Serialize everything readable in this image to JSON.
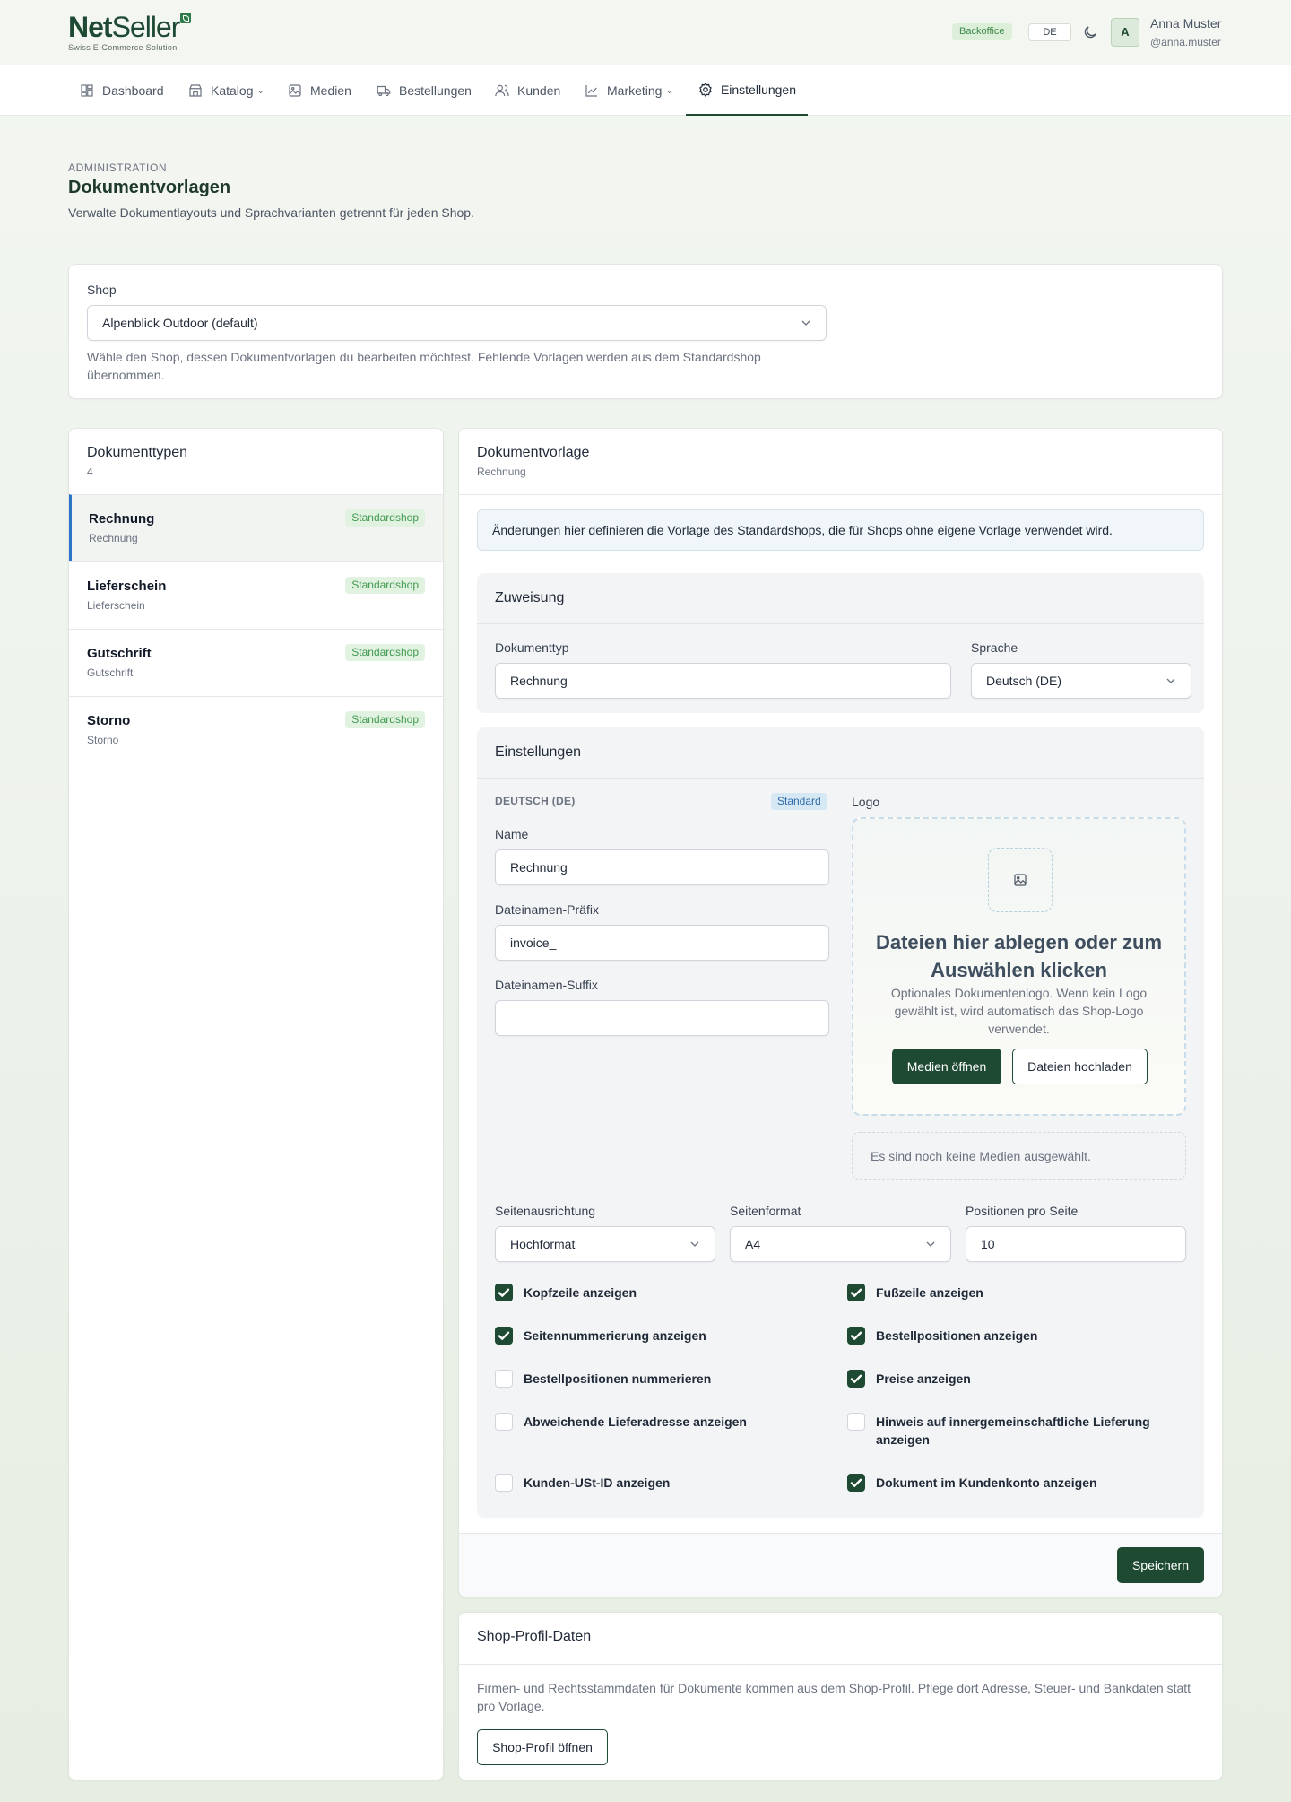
{
  "brand": {
    "name_bold": "Net",
    "name_rest": "Seller",
    "tagline": "Swiss E-Commerce Solution"
  },
  "header": {
    "backoffice_badge": "Backoffice",
    "language": "DE",
    "avatar_initial": "A",
    "user_name": "Anna Muster",
    "user_handle": "@anna.muster"
  },
  "nav": {
    "items": [
      {
        "label": "Dashboard",
        "icon": "dashboard-icon",
        "active": false
      },
      {
        "label": "Katalog",
        "icon": "store-icon",
        "active": false,
        "dropdown": true
      },
      {
        "label": "Medien",
        "icon": "image-icon",
        "active": false
      },
      {
        "label": "Bestellungen",
        "icon": "truck-icon",
        "active": false
      },
      {
        "label": "Kunden",
        "icon": "users-icon",
        "active": false
      },
      {
        "label": "Marketing",
        "icon": "chart-icon",
        "active": false,
        "dropdown": true
      },
      {
        "label": "Einstellungen",
        "icon": "gear-icon",
        "active": true
      }
    ]
  },
  "page": {
    "eyebrow": "ADMINISTRATION",
    "title": "Dokumentvorlagen",
    "subtitle": "Verwalte Dokumentlayouts und Sprachvarianten getrennt für jeden Shop."
  },
  "shop": {
    "label": "Shop",
    "value": "Alpenblick Outdoor (default)",
    "help": "Wähle den Shop, dessen Dokumentvorlagen du bearbeiten möchtest. Fehlende Vorlagen werden aus dem Standardshop übernommen."
  },
  "types": {
    "title": "Dokumenttypen",
    "count": "4",
    "items": [
      {
        "title": "Rechnung",
        "subtitle": "Rechnung",
        "badge": "Standardshop",
        "active": true
      },
      {
        "title": "Lieferschein",
        "subtitle": "Lieferschein",
        "badge": "Standardshop",
        "active": false
      },
      {
        "title": "Gutschrift",
        "subtitle": "Gutschrift",
        "badge": "Standardshop",
        "active": false
      },
      {
        "title": "Storno",
        "subtitle": "Storno",
        "badge": "Standardshop",
        "active": false
      }
    ]
  },
  "template": {
    "title": "Dokumentvorlage",
    "subtitle": "Rechnung",
    "info": "Änderungen hier definieren die Vorlage des Standardshops, die für Shops ohne eigene Vorlage verwendet wird.",
    "assignment": {
      "title": "Zuweisung",
      "doctype_label": "Dokumenttyp",
      "doctype_value": "Rechnung",
      "language_label": "Sprache",
      "language_value": "Deutsch (DE)"
    },
    "settings": {
      "title": "Einstellungen",
      "lang_heading": "DEUTSCH (DE)",
      "lang_badge": "Standard",
      "name_label": "Name",
      "name_value": "Rechnung",
      "prefix_label": "Dateinamen-Präfix",
      "prefix_value": "invoice_",
      "suffix_label": "Dateinamen-Suffix",
      "suffix_value": "",
      "logo_label": "Logo",
      "drop_title": "Dateien hier ablegen oder zum Auswählen klicken",
      "drop_help": "Optionales Dokumentenlogo. Wenn kein Logo gewählt ist, wird automatisch das Shop-Logo verwendet.",
      "open_media": "Medien öffnen",
      "upload": "Dateien hochladen",
      "no_media": "Es sind noch keine Medien ausgewählt.",
      "orientation_label": "Seitenausrichtung",
      "orientation_value": "Hochformat",
      "format_label": "Seitenformat",
      "format_value": "A4",
      "per_page_label": "Positionen pro Seite",
      "per_page_value": "10",
      "checkboxes": [
        {
          "label": "Kopfzeile anzeigen",
          "checked": true
        },
        {
          "label": "Fußzeile anzeigen",
          "checked": true
        },
        {
          "label": "Seitennummerierung anzeigen",
          "checked": true
        },
        {
          "label": "Bestellpositionen anzeigen",
          "checked": true
        },
        {
          "label": "Bestellpositionen nummerieren",
          "checked": false
        },
        {
          "label": "Preise anzeigen",
          "checked": true
        },
        {
          "label": "Abweichende Lieferadresse anzeigen",
          "checked": false
        },
        {
          "label": "Hinweis auf innergemeinschaftliche Lieferung anzeigen",
          "checked": false
        },
        {
          "label": "Kunden-USt-ID anzeigen",
          "checked": false
        },
        {
          "label": "Dokument im Kundenkonto anzeigen",
          "checked": true
        }
      ]
    },
    "save": "Speichern"
  },
  "profile": {
    "title": "Shop-Profil-Daten",
    "text": "Firmen- und Rechtsstammdaten für Dokumente kommen aus dem Shop-Profil. Pflege dort Adresse, Steuer- und Bankdaten statt pro Vorlage.",
    "button": "Shop-Profil öffnen"
  },
  "colors": {
    "brand": "#1e4a33",
    "accent_border": "#2d73c9",
    "badge_green": "#3f9a4f"
  }
}
